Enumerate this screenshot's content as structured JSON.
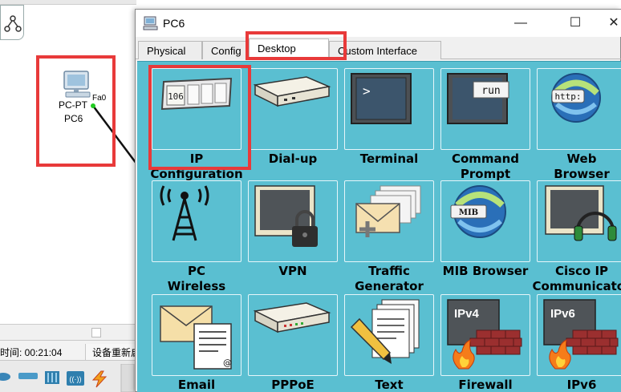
{
  "workspace": {
    "device": {
      "name": "PC-PT",
      "hostname": "PC6",
      "port": "Fa0"
    },
    "status": {
      "time": "时间: 00:21:04",
      "reset_label": "设备重新启"
    }
  },
  "dialog": {
    "title": "PC6",
    "controls": {
      "minimize": "—",
      "maximize": "☐",
      "close": "✕"
    },
    "tabs": [
      {
        "label": "Physical",
        "active": false
      },
      {
        "label": "Config",
        "active": false
      },
      {
        "label": "Desktop",
        "active": true
      },
      {
        "label": "Custom Interface",
        "active": false
      }
    ],
    "apps": [
      {
        "label": "IP\nConfiguration",
        "icon": "ip-configuration-icon",
        "icon_text": "106"
      },
      {
        "label": "Dial-up",
        "icon": "dial-up-modem-icon"
      },
      {
        "label": "Terminal",
        "icon": "terminal-icon",
        "icon_text": ">"
      },
      {
        "label": "Command\nPrompt",
        "icon": "command-prompt-icon",
        "icon_text": "run"
      },
      {
        "label": "Web\nBrowser",
        "icon": "web-browser-icon",
        "icon_text": "http:"
      },
      {
        "label": "PC\nWireless",
        "icon": "wireless-tower-icon"
      },
      {
        "label": "VPN",
        "icon": "vpn-lock-icon"
      },
      {
        "label": "Traffic\nGenerator",
        "icon": "traffic-generator-icon"
      },
      {
        "label": "MIB Browser",
        "icon": "mib-browser-icon",
        "icon_text": "MIB"
      },
      {
        "label": "Cisco IP\nCommunicator",
        "icon": "ip-communicator-icon"
      },
      {
        "label": "Email",
        "icon": "email-icon"
      },
      {
        "label": "PPPoE",
        "icon": "pppoe-dialer-icon"
      },
      {
        "label": "Text",
        "icon": "text-editor-icon"
      },
      {
        "label": "Firewall",
        "icon": "firewall-icon",
        "icon_text": "IPv4"
      },
      {
        "label": "IPv6",
        "icon": "ipv6-firewall-icon",
        "icon_text": "IPv6"
      }
    ]
  },
  "colors": {
    "desktop_bg": "#5abfd1",
    "highlight": "#e83a3a"
  }
}
